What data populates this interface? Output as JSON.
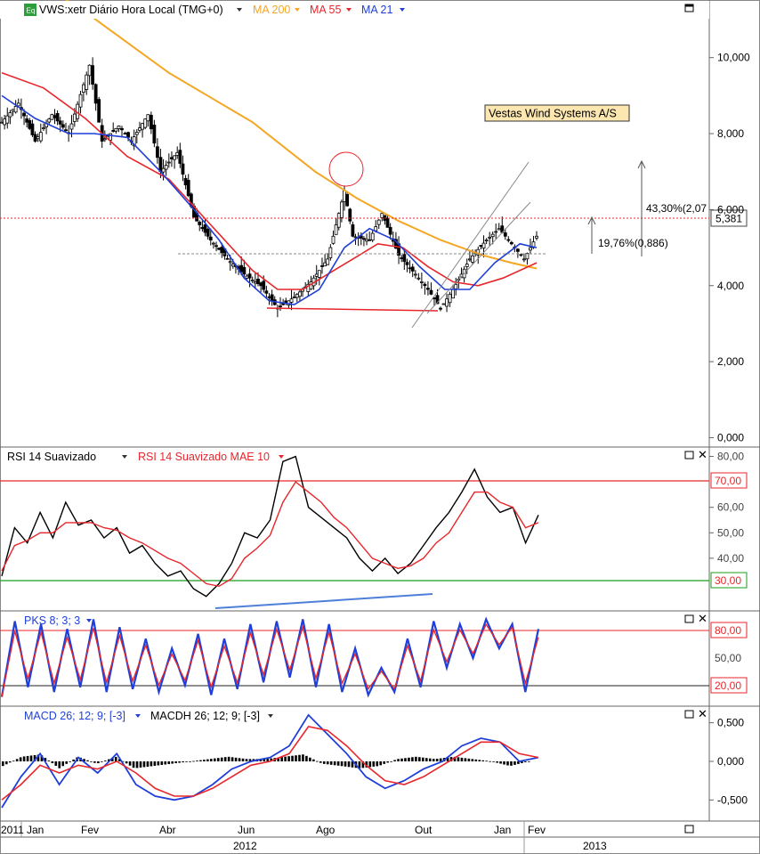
{
  "header": {
    "eq_badge": "Eq",
    "symbol": "VWS:xetr Diário Hora Local (TMG+0)",
    "indicators": [
      {
        "label": "MA 200",
        "color": "#f5a623"
      },
      {
        "label": "MA 55",
        "color": "#e8262b"
      },
      {
        "label": "MA 21",
        "color": "#1f3fd8"
      }
    ]
  },
  "annotations": {
    "company_name": "Vestas Wind Systems A/S",
    "pct_up_label": "43,30%(2,07",
    "pct_lower_label": "19,76%(0,886)",
    "last_price": "5,381"
  },
  "rsi_panel": {
    "label1": "RSI 14 Suavizado",
    "label2": "RSI 14 Suavizado MAE 10",
    "level_high": "70,00",
    "level_low": "30,00"
  },
  "pks_panel": {
    "label": "PKS 8; 3; 3",
    "level_high": "80,00",
    "level_mid": "50,00",
    "level_low": "20,00"
  },
  "macd_panel": {
    "label1": "MACD 26; 12; 9; [-3]",
    "label2": "MACDH 26; 12; 9; [-3]"
  },
  "time_axis": {
    "months": [
      "2011",
      "Jan",
      "Fev",
      "Abr",
      "Jun",
      "Ago",
      "Out",
      "Jan",
      "Fev"
    ],
    "years": [
      "2012",
      "2013"
    ]
  },
  "colors": {
    "price_candles": "#000000",
    "ma200": "#f5a623",
    "ma55": "#e8262b",
    "ma21": "#1f3fd8",
    "rsi": "#000000",
    "rsi_mae": "#e8262b",
    "level_red": "#e8262b",
    "level_green": "#1a9e1a",
    "pks_k": "#1f3fd8",
    "pks_d": "#e8262b",
    "macd": "#1f3fd8",
    "macd_signal": "#e8262b"
  },
  "chart_data": [
    {
      "type": "line",
      "title": "VWS:xetr Diário Hora Local (TMG+0)",
      "y_ticks": [
        "0,000",
        "2,000",
        "4,000",
        "6,000",
        "8,000",
        "10,000"
      ],
      "ylim": [
        -0.2,
        11
      ],
      "x_labels": [
        "Jan",
        "Fev",
        "Abr",
        "Jun",
        "Ago",
        "Out",
        "Jan",
        "Fev"
      ],
      "series": [
        {
          "name": "VWS",
          "points": [
            [
              0,
              8.3
            ],
            [
              4,
              8.8
            ],
            [
              8,
              7.8
            ],
            [
              12,
              8.5
            ],
            [
              16,
              8.0
            ],
            [
              21,
              9.8
            ],
            [
              24,
              7.8
            ],
            [
              28,
              8.2
            ],
            [
              31,
              7.8
            ],
            [
              35,
              8.5
            ],
            [
              38,
              7.0
            ],
            [
              42,
              7.5
            ],
            [
              46,
              5.8
            ],
            [
              50,
              5.2
            ],
            [
              54,
              4.7
            ],
            [
              58,
              4.3
            ],
            [
              62,
              4.0
            ],
            [
              66,
              3.4
            ],
            [
              70,
              3.7
            ],
            [
              74,
              4.1
            ],
            [
              78,
              4.7
            ],
            [
              82,
              6.5
            ],
            [
              84,
              5.3
            ],
            [
              88,
              5.2
            ],
            [
              91,
              5.9
            ],
            [
              95,
              4.8
            ],
            [
              99,
              4.3
            ],
            [
              102,
              3.9
            ],
            [
              105,
              3.4
            ],
            [
              108,
              3.9
            ],
            [
              112,
              4.7
            ],
            [
              116,
              5.2
            ],
            [
              119,
              5.5
            ],
            [
              122,
              5.1
            ],
            [
              125,
              4.7
            ],
            [
              128,
              5.3
            ]
          ]
        },
        {
          "name": "MA 200",
          "points": [
            [
              0,
              12.6
            ],
            [
              20,
              11.2
            ],
            [
              40,
              9.6
            ],
            [
              60,
              8.3
            ],
            [
              75,
              7.0
            ],
            [
              85,
              6.3
            ],
            [
              95,
              5.7
            ],
            [
              105,
              5.2
            ],
            [
              115,
              4.8
            ],
            [
              122,
              4.6
            ],
            [
              128,
              4.45
            ]
          ]
        },
        {
          "name": "MA 55",
          "points": [
            [
              0,
              9.6
            ],
            [
              10,
              9.2
            ],
            [
              20,
              8.4
            ],
            [
              30,
              7.4
            ],
            [
              40,
              6.8
            ],
            [
              50,
              5.6
            ],
            [
              60,
              4.4
            ],
            [
              66,
              3.9
            ],
            [
              72,
              3.9
            ],
            [
              78,
              4.3
            ],
            [
              84,
              4.7
            ],
            [
              90,
              5.1
            ],
            [
              96,
              5.0
            ],
            [
              102,
              4.5
            ],
            [
              108,
              4.1
            ],
            [
              114,
              4.0
            ],
            [
              120,
              4.2
            ],
            [
              128,
              4.6
            ]
          ]
        },
        {
          "name": "MA 21",
          "points": [
            [
              0,
              9.0
            ],
            [
              8,
              8.4
            ],
            [
              16,
              8.0
            ],
            [
              22,
              8.0
            ],
            [
              30,
              7.9
            ],
            [
              38,
              7.0
            ],
            [
              46,
              6.0
            ],
            [
              52,
              5.2
            ],
            [
              58,
              4.2
            ],
            [
              64,
              3.6
            ],
            [
              70,
              3.5
            ],
            [
              76,
              3.9
            ],
            [
              82,
              5.0
            ],
            [
              88,
              5.5
            ],
            [
              94,
              5.2
            ],
            [
              100,
              4.5
            ],
            [
              106,
              3.9
            ],
            [
              112,
              3.9
            ],
            [
              118,
              4.6
            ],
            [
              124,
              5.1
            ],
            [
              128,
              5.0
            ]
          ]
        }
      ]
    },
    {
      "type": "line",
      "title": "RSI 14 Suavizado",
      "y_ticks": [
        "40,00",
        "50,00",
        "60,00",
        "80,00"
      ],
      "ylim": [
        20,
        83
      ],
      "series": [
        {
          "name": "RSI 14 Suavizado",
          "values": [
            33,
            52,
            46,
            58,
            48,
            62,
            53,
            55,
            48,
            52,
            42,
            45,
            38,
            33,
            35,
            28,
            25,
            30,
            38,
            50,
            48,
            55,
            78,
            80,
            60,
            56,
            52,
            48,
            40,
            35,
            40,
            34,
            38,
            45,
            52,
            58,
            66,
            75,
            64,
            58,
            60,
            46,
            57
          ]
        },
        {
          "name": "RSI 14 Suavizado MAE 10",
          "values": [
            35,
            45,
            47,
            50,
            50,
            54,
            54,
            54,
            52,
            51,
            48,
            46,
            43,
            40,
            38,
            34,
            30,
            29,
            32,
            40,
            44,
            49,
            62,
            70,
            66,
            62,
            56,
            52,
            46,
            40,
            38,
            36,
            37,
            40,
            46,
            50,
            58,
            66,
            66,
            62,
            60,
            52,
            54
          ]
        }
      ]
    },
    {
      "type": "line",
      "title": "PKS 8; 3; 3",
      "y_ticks": [
        "50,00"
      ],
      "ylim": [
        5,
        95
      ],
      "series": [
        {
          "name": "PKS 8; 3; 3",
          "values": [
            10,
            88,
            20,
            85,
            15,
            80,
            20,
            90,
            15,
            82,
            18,
            70,
            15,
            60,
            22,
            75,
            12,
            70,
            18,
            85,
            25,
            88,
            30,
            90,
            20,
            85,
            15,
            60,
            12,
            40,
            15,
            70,
            20,
            88,
            40,
            85,
            50,
            90,
            60,
            85,
            15,
            80
          ]
        }
      ]
    },
    {
      "type": "line",
      "title": "MACD 26; 12; 9; [-3]",
      "y_ticks": [
        "0,500",
        "0,000",
        "-0,500"
      ],
      "ylim": [
        -0.75,
        0.68
      ],
      "series": [
        {
          "name": "MACD 26; 12; 9; [-3]",
          "values": [
            -0.6,
            -0.2,
            0.1,
            -0.3,
            0.05,
            -0.15,
            0.1,
            -0.3,
            -0.45,
            -0.5,
            -0.45,
            -0.3,
            -0.1,
            0.0,
            0.05,
            0.2,
            0.6,
            0.35,
            0.1,
            -0.2,
            -0.35,
            -0.25,
            -0.1,
            0.0,
            0.2,
            0.3,
            0.25,
            0.0,
            0.05
          ]
        },
        {
          "name": "MACDH 26; 12; 9; [-3]",
          "values": [
            -0.5,
            -0.3,
            -0.05,
            -0.15,
            -0.05,
            -0.1,
            0.0,
            -0.15,
            -0.35,
            -0.45,
            -0.45,
            -0.35,
            -0.2,
            -0.05,
            0.0,
            0.1,
            0.45,
            0.4,
            0.2,
            -0.05,
            -0.25,
            -0.3,
            -0.2,
            -0.05,
            0.1,
            0.25,
            0.25,
            0.1,
            0.05
          ]
        }
      ]
    }
  ]
}
